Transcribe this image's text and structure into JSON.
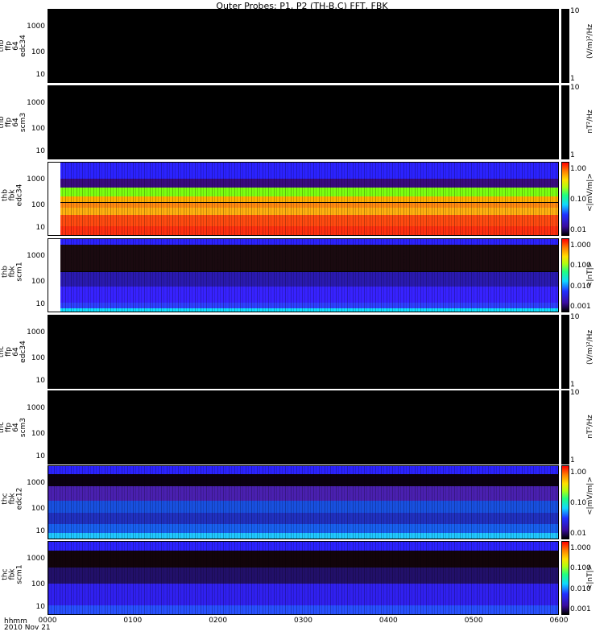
{
  "title": "Outer Probes: P1, P2 (TH-B,C) FFT, FBK",
  "x_format": "hhmm",
  "x_date": "2010 Nov 21",
  "chart_data": {
    "type": "heatmap",
    "x_ticks": [
      "0000",
      "0100",
      "0200",
      "0300",
      "0400",
      "0500",
      "0600"
    ],
    "x_range": [
      "0000",
      "0600"
    ],
    "panels": [
      {
        "id": "thb-ffp-edc34",
        "label": "thb\nffp\n64\nedc34",
        "yticks": [
          "1000",
          "100",
          "10"
        ],
        "cb_ticks": [
          "10",
          "1"
        ],
        "cb_label": "(V/m)²/Hz",
        "cb_type": "mono"
      },
      {
        "id": "thb-ffp-scm3",
        "label": "thb\nffp\n64\nscm3",
        "yticks": [
          "1000",
          "100",
          "10"
        ],
        "cb_ticks": [
          "10",
          "1"
        ],
        "cb_label": "nT²/Hz",
        "cb_type": "mono"
      },
      {
        "id": "thb-fbk-edc34",
        "label": "thb\nfbk\nedc34",
        "yticks": [
          "1000",
          "100",
          "10"
        ],
        "cb_ticks": [
          "1.00",
          "0.10",
          "0.01"
        ],
        "cb_label": "<|mV/m|>",
        "cb_type": "rainbow",
        "bands": [
          {
            "from": 1,
            "to": 0.78,
            "color": "#2b22ff"
          },
          {
            "from": 0.78,
            "to": 0.66,
            "color": "#3a0a80"
          },
          {
            "from": 0.66,
            "to": 0.53,
            "color": "#7cff10"
          },
          {
            "from": 0.53,
            "to": 0.45,
            "color": "#ffb000"
          },
          {
            "from": 0.45,
            "to": 0.38,
            "color": "#ff8a10"
          },
          {
            "from": 0.38,
            "to": 0.28,
            "color": "#ffb010"
          },
          {
            "from": 0.28,
            "to": 0.12,
            "color": "#ff4a10"
          },
          {
            "from": 0.12,
            "to": 0,
            "color": "#ff3010"
          }
        ]
      },
      {
        "id": "thb-fbk-scm1",
        "label": "thb\nfbk\nscm1",
        "yticks": [
          "1000",
          "100",
          "10"
        ],
        "cb_ticks": [
          "1.000",
          "0.100",
          "0.010",
          "0.001"
        ],
        "cb_label": "<|nT|>",
        "cb_type": "rainbow",
        "bands": [
          {
            "from": 1,
            "to": 0.92,
            "color": "#2b22ff"
          },
          {
            "from": 0.92,
            "to": 0.55,
            "color": "#1a0a10"
          },
          {
            "from": 0.55,
            "to": 0.35,
            "color": "#2a1ab0"
          },
          {
            "from": 0.35,
            "to": 0.12,
            "color": "#3722ff"
          },
          {
            "from": 0.12,
            "to": 0.04,
            "color": "#2f40ff"
          },
          {
            "from": 0.04,
            "to": 0,
            "color": "#10e0ff"
          }
        ]
      },
      {
        "id": "thc-ffp-edc34",
        "label": "thc\nffp\n64\nedc34",
        "yticks": [
          "1000",
          "100",
          "10"
        ],
        "cb_ticks": [
          "10",
          "1"
        ],
        "cb_label": "(V/m)²/Hz",
        "cb_type": "mono"
      },
      {
        "id": "thc-ffp-scm3",
        "label": "thc\nffp\n64\nscm3",
        "yticks": [
          "1000",
          "100",
          "10"
        ],
        "cb_ticks": [
          "10",
          "1"
        ],
        "cb_label": "nT²/Hz",
        "cb_type": "mono"
      },
      {
        "id": "thc-fbk-edc12",
        "label": "thc\nfbk\nedc12",
        "yticks": [
          "1000",
          "100",
          "10"
        ],
        "cb_ticks": [
          "1.00",
          "0.10",
          "0.01"
        ],
        "cb_label": "<|mV/m|>",
        "cb_type": "rainbow",
        "bands": [
          {
            "from": 1,
            "to": 0.89,
            "color": "#2b22ff"
          },
          {
            "from": 0.89,
            "to": 0.72,
            "color": "#0a0010"
          },
          {
            "from": 0.72,
            "to": 0.52,
            "color": "#4a20b0"
          },
          {
            "from": 0.52,
            "to": 0.36,
            "color": "#1850e0"
          },
          {
            "from": 0.36,
            "to": 0.2,
            "color": "#2030c0"
          },
          {
            "from": 0.2,
            "to": 0.08,
            "color": "#1860f0"
          },
          {
            "from": 0.08,
            "to": 0,
            "color": "#20c8ff"
          }
        ]
      },
      {
        "id": "thc-fbk-scm1",
        "label": "thc\nfbk\nscm1",
        "yticks": [
          "1000",
          "100",
          "10"
        ],
        "cb_ticks": [
          "1.000",
          "0.100",
          "0.010",
          "0.001"
        ],
        "cb_label": "<|nT|>",
        "cb_type": "rainbow",
        "bands": [
          {
            "from": 1,
            "to": 0.88,
            "color": "#2b22ff"
          },
          {
            "from": 0.88,
            "to": 0.64,
            "color": "#12040a"
          },
          {
            "from": 0.64,
            "to": 0.42,
            "color": "#22106a"
          },
          {
            "from": 0.42,
            "to": 0.12,
            "color": "#3020f0"
          },
          {
            "from": 0.12,
            "to": 0,
            "color": "#2850ff"
          }
        ]
      }
    ]
  }
}
